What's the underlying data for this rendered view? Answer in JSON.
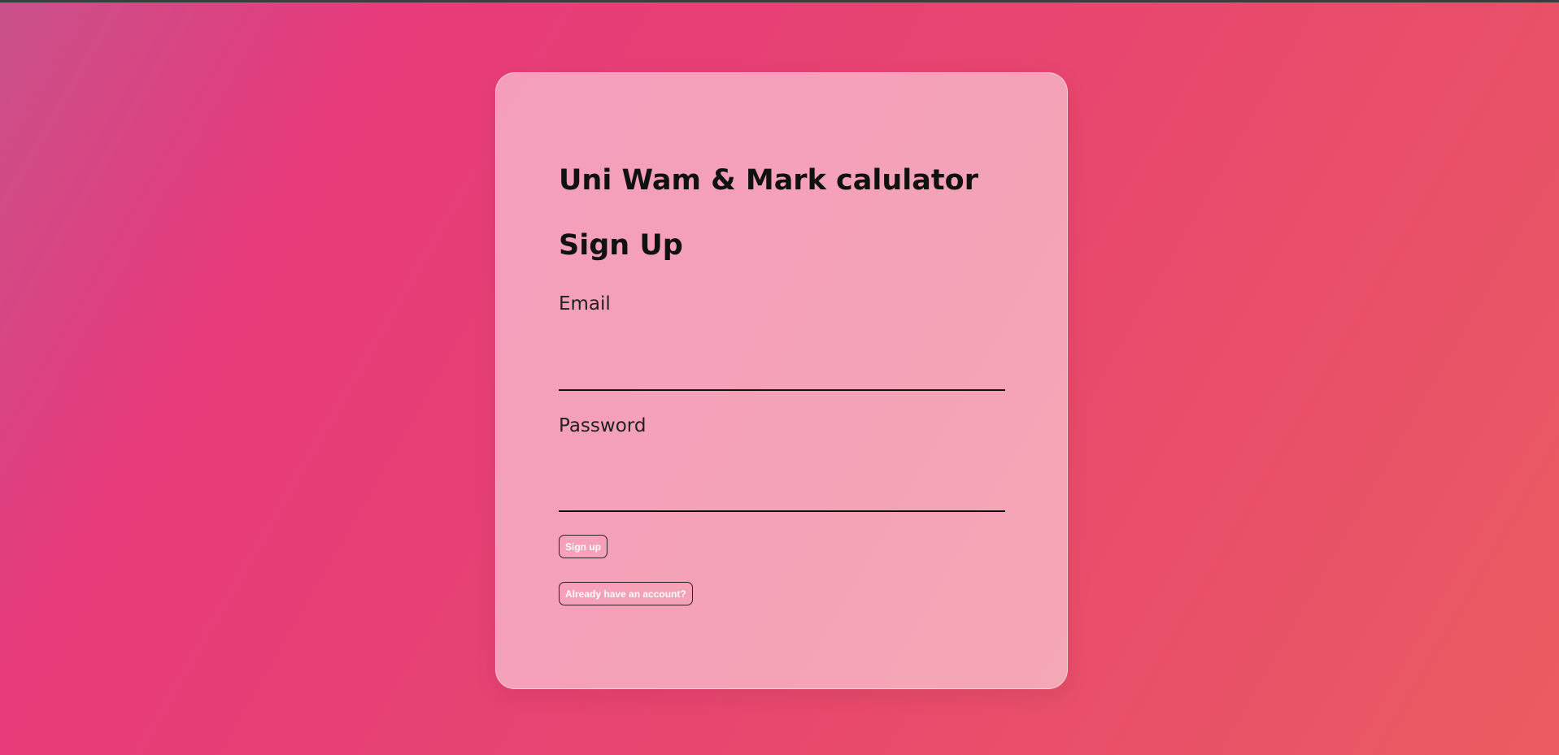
{
  "app": {
    "title": "Uni Wam & Mark calulator",
    "heading": "Sign Up"
  },
  "form": {
    "email_label": "Email",
    "email_value": "",
    "password_label": "Password",
    "password_value": "",
    "signup_label": "Sign up",
    "login_link_label": "Already have an account?"
  },
  "colors": {
    "gradient_start": "#c8508a",
    "gradient_mid": "#e83b7c",
    "gradient_end": "#ea5c62"
  }
}
